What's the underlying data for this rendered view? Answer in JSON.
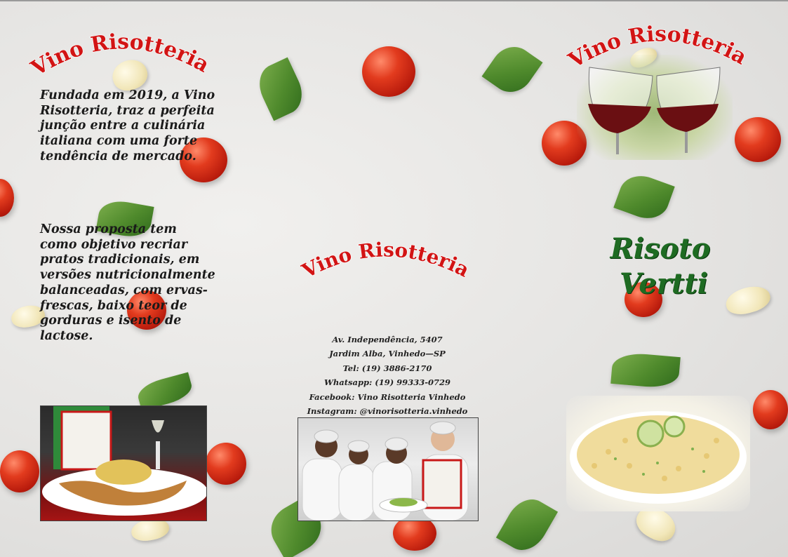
{
  "brand": {
    "name": "Vino Risotteria"
  },
  "left_panel": {
    "title": "Vino Risotteria",
    "paragraph_1": "Fundada em 2019, a Vino  Risotteria, traz a perfeita junção entre a culinária italiana com uma forte tendência de mercado.",
    "paragraph_2": "Nossa proposta tem como objetivo recriar pratos tradicionais, em versões nutricionalmente balanceadas, com ervas-frescas, baixo teor de gorduras e isento de lactose."
  },
  "middle_panel": {
    "title": "Vino Risotteria",
    "contact_lines": [
      "Av. Independência, 5407",
      "Jardim Alba, Vinhedo—SP",
      "Tel: (19) 3886-2170",
      "Whatsapp: (19) 99333-0729",
      "Facebook: Vino Risotteria Vinhedo",
      "Instagram: @vinorisotteria.vinhedo"
    ]
  },
  "right_panel": {
    "title": "Vino Risotteria",
    "product_line_1": "Risoto",
    "product_line_2": "Vertti"
  },
  "colors": {
    "title_red": "#d21414",
    "product_green": "#1e6b22",
    "text_dark": "#1a1a1a"
  },
  "icons": [
    "tomato-icon",
    "basil-leaf-icon",
    "garlic-icon",
    "wine-glass-icon"
  ]
}
